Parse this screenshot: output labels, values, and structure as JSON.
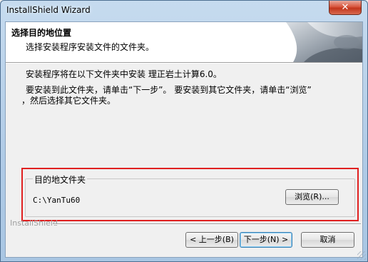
{
  "window": {
    "title": "InstallShield Wizard",
    "close_label": "✕"
  },
  "header": {
    "title": "选择目的地位置",
    "subtitle": "选择安装程序安装文件的文件夹。"
  },
  "body": {
    "info_line1": "安装程序将在以下文件夹中安装 理正岩土计算6.0。",
    "info_line2": "要安装到此文件夹，请单击“下一步”。 要安装到其它文件夹，请单击“浏览”",
    "info_line3": "，然后选择其它文件夹。"
  },
  "destination": {
    "legend": "目的地文件夹",
    "path": "C:\\YanTu60",
    "browse_label": "浏览(R)..."
  },
  "footer": {
    "brand": "InstallShield",
    "back_label": "< 上一步(B)",
    "next_label": "下一步(N) >",
    "cancel_label": "取消"
  },
  "colors": {
    "highlight": "#e02020",
    "titlebar": "#b0cbe6"
  }
}
